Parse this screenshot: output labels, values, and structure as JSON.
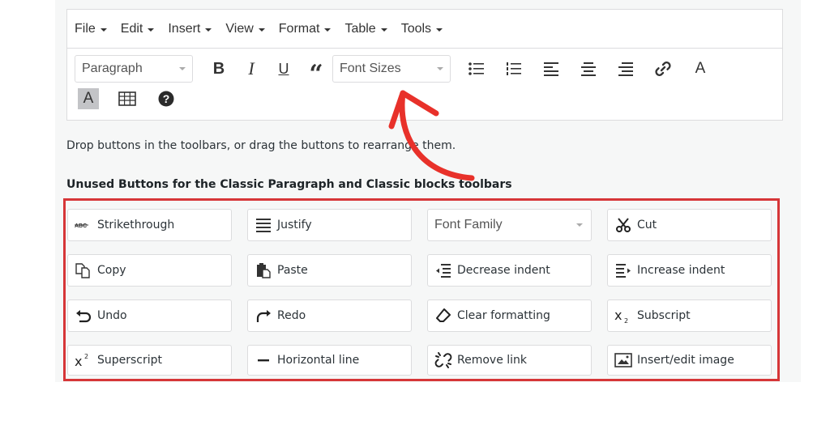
{
  "menubar": {
    "items": [
      "File",
      "Edit",
      "Insert",
      "View",
      "Format",
      "Table",
      "Tools"
    ]
  },
  "toolbar": {
    "format_select": "Paragraph",
    "font_size_select": "Font Sizes",
    "buttons": [
      "bold",
      "italic",
      "underline",
      "blockquote",
      "bulleted-list",
      "numbered-list",
      "align-left",
      "align-center",
      "align-right",
      "link",
      "text-color"
    ],
    "row2": [
      "background-color",
      "table",
      "help"
    ],
    "bold_label": "B",
    "italic_label": "I",
    "underline_label": "U",
    "quote_label": "“",
    "text_color_label": "A",
    "bg_color_label": "A",
    "help_label": "?"
  },
  "hint_text": "Drop buttons in the toolbars, or drag the buttons to rearrange them.",
  "unused_heading": "Unused Buttons for the Classic Paragraph and Classic blocks toolbars",
  "unused_buttons": [
    {
      "label": "Strikethrough",
      "icon": "strikethrough-icon"
    },
    {
      "label": "Justify",
      "icon": "justify-icon"
    },
    {
      "label": "Font Family",
      "icon": "dropdown"
    },
    {
      "label": "Cut",
      "icon": "scissors-icon"
    },
    {
      "label": "Copy",
      "icon": "copy-icon"
    },
    {
      "label": "Paste",
      "icon": "paste-icon"
    },
    {
      "label": "Decrease indent",
      "icon": "outdent-icon"
    },
    {
      "label": "Increase indent",
      "icon": "indent-icon"
    },
    {
      "label": "Undo",
      "icon": "undo-icon"
    },
    {
      "label": "Redo",
      "icon": "redo-icon"
    },
    {
      "label": "Clear formatting",
      "icon": "eraser-icon"
    },
    {
      "label": "Subscript",
      "icon": "subscript-icon"
    },
    {
      "label": "Superscript",
      "icon": "superscript-icon"
    },
    {
      "label": "Horizontal line",
      "icon": "horizontal-line-icon"
    },
    {
      "label": "Remove link",
      "icon": "unlink-icon"
    },
    {
      "label": "Insert/edit image",
      "icon": "image-icon"
    }
  ],
  "colors": {
    "highlight": "#d63638",
    "annotation_arrow": "#e8312a",
    "panel_bg": "#f6f7f7",
    "border": "#dcdcde"
  }
}
